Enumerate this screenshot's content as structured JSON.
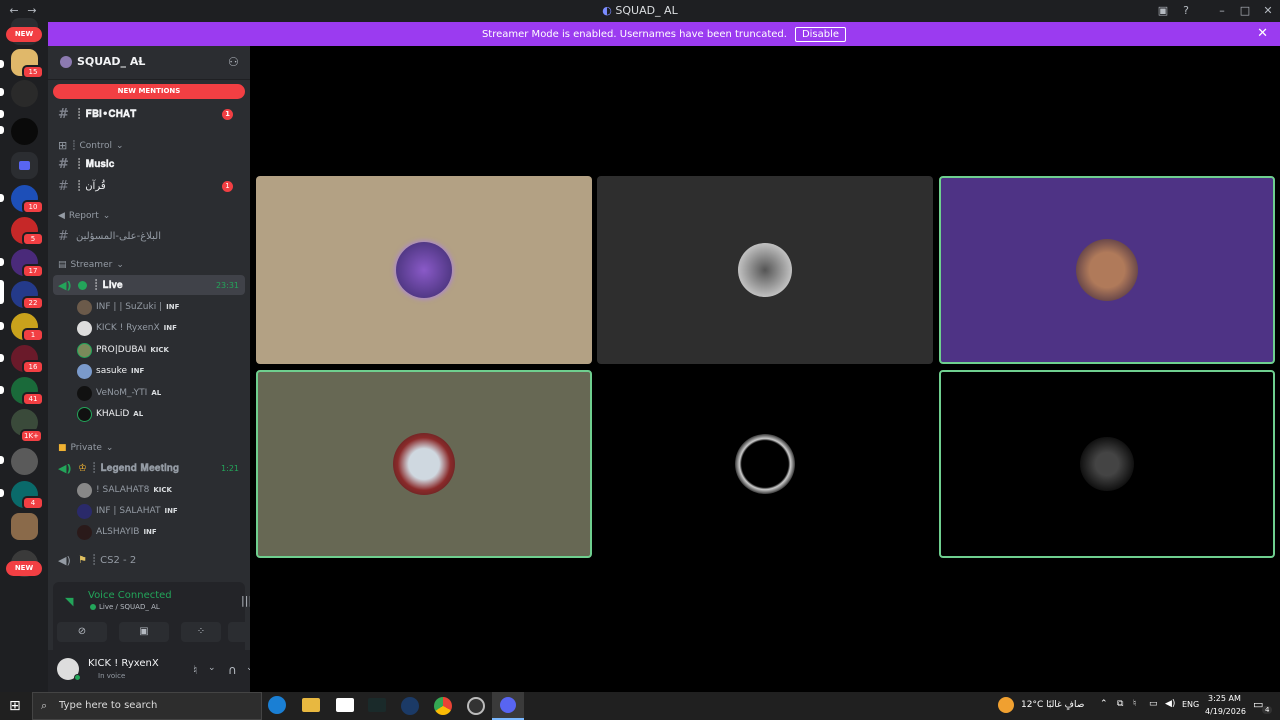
{
  "window": {
    "title": "SQUAD_ AL"
  },
  "banner": {
    "text": "Streamer Mode is enabled. Usernames have been truncated.",
    "disable_label": "Disable"
  },
  "guilds": {
    "new_top": "NEW",
    "new_bottom": "NEW",
    "badges": [
      "15",
      "10",
      "5",
      "17",
      "22",
      "1",
      "16",
      "41",
      "1K+",
      "4"
    ]
  },
  "server": {
    "name": "SQUAD_ AL",
    "new_mentions": "NEW MENTIONS",
    "channels": {
      "fbi_chat": "┊ 𝐅𝐁𝐈•𝐂𝐇𝐀𝐓",
      "fbi_badge": "1",
      "control_cat": "┊ Control",
      "music": "┊ 𝐌𝐮𝐬𝐢𝐜",
      "quran": "┊ قُرآن",
      "quran_badge": "1",
      "report_cat": "Report",
      "report_channel": "البلاغ-على-المسؤلين",
      "streamer_cat": "Streamer",
      "live": "┊ 𝐋𝐢𝐯𝐞",
      "live_time": "23:31",
      "private_cat": "Private",
      "legend": "┊ 𝐋𝐞𝐠𝐞𝐧𝐝 𝐌𝐞𝐞𝐭𝐢𝐧𝐠",
      "legend_time": "1:21",
      "cs2": "┊ CS2 - 2"
    },
    "live_users": [
      {
        "name": "INF | | SuZuki |",
        "tag": "INF"
      },
      {
        "name": "KICK ! RyxenX",
        "tag": "INF"
      },
      {
        "name": "PRO|DUBAI",
        "tag": "KICK"
      },
      {
        "name": "sasuke",
        "tag": "INF"
      },
      {
        "name": "VeNoM_-YTI",
        "tag": "AL"
      },
      {
        "name": "KHALiD",
        "tag": "AL"
      }
    ],
    "legend_users": [
      {
        "name": "! SALAHAT8",
        "tag": "KICK"
      },
      {
        "name": "INF | SALAHAT",
        "tag": "INF"
      },
      {
        "name": "ALSHAYIB",
        "tag": "INF"
      }
    ]
  },
  "voice": {
    "status": "Voice Connected",
    "channel": "Live / SQUAD_ AL"
  },
  "user": {
    "name": "KICK ! RyxenX",
    "status": "In voice"
  },
  "taskbar": {
    "search_placeholder": "Type here to search",
    "weather": "12°C  صافٍ غالبًا",
    "lang": "ENG",
    "time": "3:25 AM",
    "date": "4/19/2026",
    "notif": "4"
  },
  "colors": {
    "accent": "#9b3bf0",
    "green": "#23a55a",
    "red": "#f23f43"
  }
}
